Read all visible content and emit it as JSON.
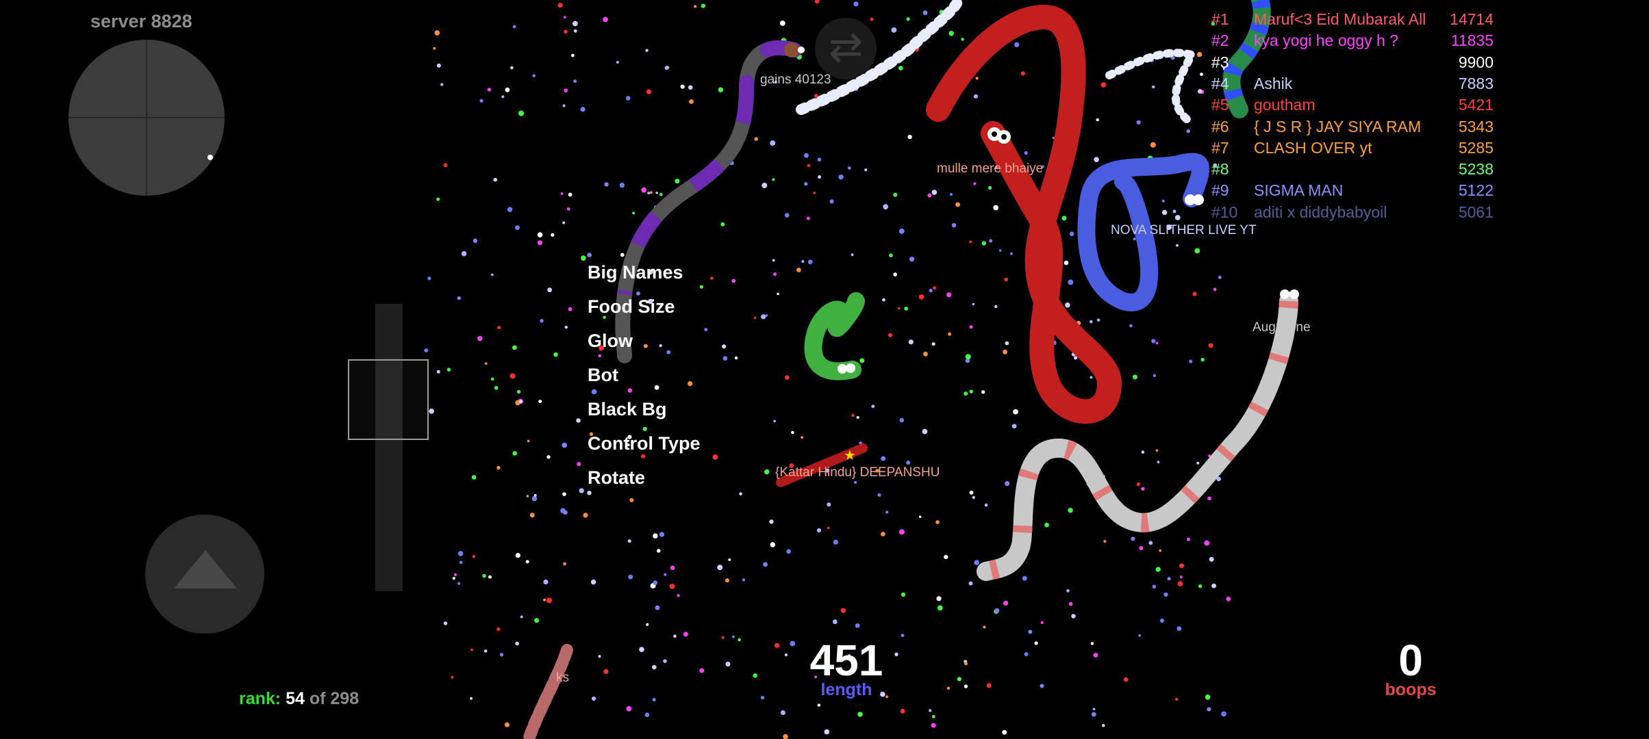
{
  "server_label": "server 8828",
  "menu": {
    "items": [
      "Big Names",
      "Food Size",
      "Glow",
      "Bot",
      "Black Bg",
      "Control Type",
      "Rotate"
    ]
  },
  "leaderboard": [
    {
      "rank": "#1",
      "name": "Maruf<3 Eid Mubarak All",
      "score": "14714",
      "color": "#ff5a6e"
    },
    {
      "rank": "#2",
      "name": "kya yogi he oggy h ?",
      "score": "11835",
      "color": "#ff44ff"
    },
    {
      "rank": "#3",
      "name": "",
      "score": "9900",
      "color": "#ffffff"
    },
    {
      "rank": "#4",
      "name": "Ashik",
      "score": "7883",
      "color": "#c8d2ff"
    },
    {
      "rank": "#5",
      "name": "goutham",
      "score": "5421",
      "color": "#ff4040"
    },
    {
      "rank": "#6",
      "name": "{ J S R } JAY SIYA RAM",
      "score": "5343",
      "color": "#ffa040"
    },
    {
      "rank": "#7",
      "name": "CLASH OVER yt",
      "score": "5285",
      "color": "#ffa040"
    },
    {
      "rank": "#8",
      "name": "",
      "score": "5238",
      "color": "#70ff70"
    },
    {
      "rank": "#9",
      "name": "SIGMA MAN",
      "score": "5122",
      "color": "#8f8fff"
    },
    {
      "rank": "#10",
      "name": "aditi x diddybabyoil",
      "score": "5061",
      "color": "#5a5a9a"
    }
  ],
  "snake_labels": {
    "gains": "gains 40123",
    "mulle": "mulle mere bhaiye",
    "nova": "NOVA SLITHER LIVE YT",
    "augustine": "Augustine",
    "deepanshu": "{Kattar Hindu} DEEPANSHU",
    "ks": "ks"
  },
  "stats": {
    "length_value": "451",
    "length_label": "length",
    "boops_value": "0",
    "boops_label": "boops"
  },
  "rank": {
    "label": "rank:",
    "value": "54",
    "of_text": "of 298"
  },
  "colors": {
    "length_label": "#5a5aff",
    "boops_label": "#e04a4a",
    "rank_label": "#33dd33",
    "rank_of": "#8c8c8c"
  },
  "icons": {
    "swap": "swap-arrows-icon",
    "boost": "triangle-up-icon"
  }
}
